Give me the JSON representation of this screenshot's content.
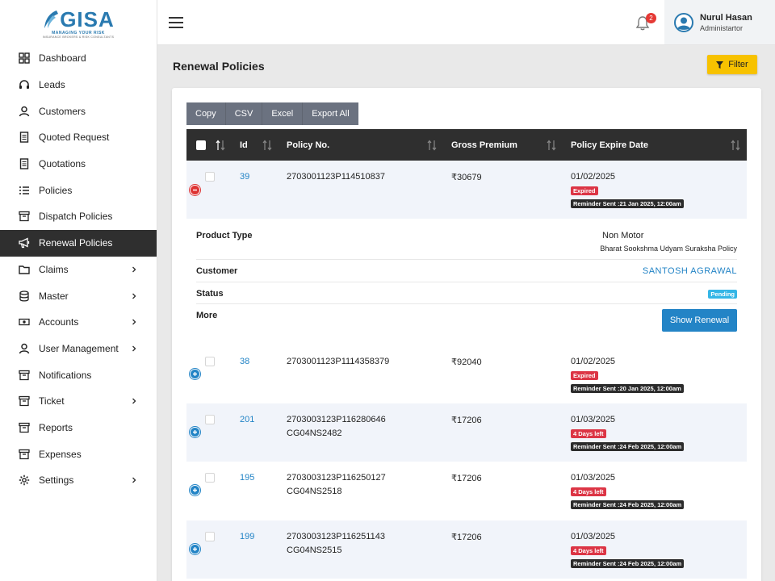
{
  "brand": {
    "name": "GISA",
    "tagline": "MANAGING YOUR RISK",
    "subtagline": "INSURANCE BROKERS & RISK CONSULTANTS"
  },
  "sidebar": {
    "items": [
      {
        "label": "Dashboard",
        "icon": "dashboard-icon"
      },
      {
        "label": "Leads",
        "icon": "headset-icon"
      },
      {
        "label": "Customers",
        "icon": "user-icon"
      },
      {
        "label": "Quoted Request",
        "icon": "document-icon"
      },
      {
        "label": "Quotations",
        "icon": "document-icon"
      },
      {
        "label": "Policies",
        "icon": "list-icon"
      },
      {
        "label": "Dispatch Policies",
        "icon": "archive-icon"
      },
      {
        "label": "Renewal Policies",
        "icon": "megaphone-icon",
        "active": true
      },
      {
        "label": "Claims",
        "icon": "folder-icon",
        "has_children": true
      },
      {
        "label": "Master",
        "icon": "database-icon",
        "has_children": true
      },
      {
        "label": "Accounts",
        "icon": "money-icon",
        "has_children": true
      },
      {
        "label": "User Management",
        "icon": "user-icon",
        "has_children": true
      },
      {
        "label": "Notifications",
        "icon": "archive-icon"
      },
      {
        "label": "Ticket",
        "icon": "archive-icon",
        "has_children": true
      },
      {
        "label": "Reports",
        "icon": "archive-icon"
      },
      {
        "label": "Expenses",
        "icon": "archive-icon"
      },
      {
        "label": "Settings",
        "icon": "gear-icon",
        "has_children": true
      }
    ]
  },
  "header": {
    "notification_count": "2",
    "user_name": "Nurul Hasan",
    "user_role": "Administartor"
  },
  "page": {
    "title": "Renewal Policies",
    "filter_label": "Filter"
  },
  "exports": [
    "Copy",
    "CSV",
    "Excel",
    "Export All"
  ],
  "table": {
    "columns": [
      "Id",
      "Policy No.",
      "Gross Premium",
      "Policy Expire Date"
    ],
    "rows": [
      {
        "id": "39",
        "policy_no": "2703001123P114510837",
        "policy_no2": "",
        "premium": "₹30679",
        "expire": "01/02/2025",
        "status": "Expired",
        "reminder": "Reminder Sent :21 Jan 2025, 12:00am",
        "expanded": true
      },
      {
        "id": "38",
        "policy_no": "2703001123P1114358379",
        "policy_no2": "",
        "premium": "₹92040",
        "expire": "01/02/2025",
        "status": "Expired",
        "reminder": "Reminder Sent :20 Jan 2025, 12:00am"
      },
      {
        "id": "201",
        "policy_no": "2703003123P116280646",
        "policy_no2": "CG04NS2482",
        "premium": "₹17206",
        "expire": "01/03/2025",
        "status": "4 Days left",
        "reminder": "Reminder Sent :24 Feb 2025, 12:00am"
      },
      {
        "id": "195",
        "policy_no": "2703003123P116250127",
        "policy_no2": "CG04NS2518",
        "premium": "₹17206",
        "expire": "01/03/2025",
        "status": "4 Days left",
        "reminder": "Reminder Sent :24 Feb 2025, 12:00am"
      },
      {
        "id": "199",
        "policy_no": "2703003123P116251143",
        "policy_no2": "CG04NS2515",
        "premium": "₹17206",
        "expire": "01/03/2025",
        "status": "4 Days left",
        "reminder": "Reminder Sent :24 Feb 2025, 12:00am"
      }
    ]
  },
  "detail": {
    "product_type_label": "Product Type",
    "product_type_value": "Non Motor",
    "product_name": "Bharat Sookshma Udyam Suraksha Policy",
    "customer_label": "Customer",
    "customer_value": "SANTOSH AGRAWAL",
    "status_label": "Status",
    "status_value": "Pending",
    "more_label": "More",
    "show_renewal_label": "Show Renewal"
  },
  "colors": {
    "accent": "#2384c6",
    "active_nav": "#2f2f2f",
    "filter": "#f7c200",
    "danger": "#dc3545"
  }
}
